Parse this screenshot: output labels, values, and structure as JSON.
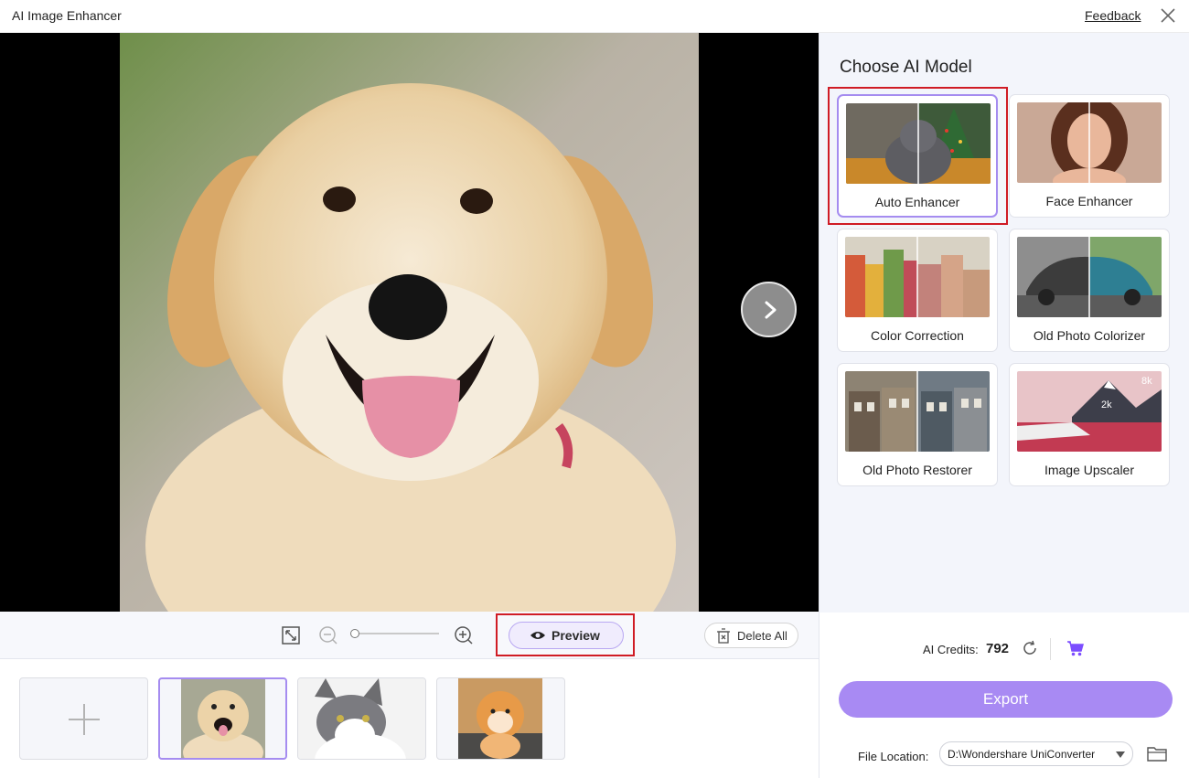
{
  "window": {
    "title": "AI Image Enhancer",
    "feedback_label": "Feedback"
  },
  "toolbar": {
    "preview_label": "Preview",
    "delete_all_label": "Delete All"
  },
  "panel": {
    "title": "Choose AI Model",
    "models": [
      {
        "label": "Auto Enhancer",
        "selected": true
      },
      {
        "label": "Face Enhancer",
        "selected": false
      },
      {
        "label": "Color Correction",
        "selected": false
      },
      {
        "label": "Old Photo Colorizer",
        "selected": false
      },
      {
        "label": "Old Photo Restorer",
        "selected": false
      },
      {
        "label": "Image Upscaler",
        "selected": false
      }
    ],
    "upscaler_badges": [
      "8k",
      "2k"
    ]
  },
  "footer": {
    "credits_label": "AI Credits:",
    "credits_value": "792",
    "export_label": "Export",
    "file_location_label": "File Location:",
    "file_location_value": "D:\\Wondershare UniConverter"
  },
  "colors": {
    "accent": "#a88af3",
    "highlight": "#d01c25",
    "cart": "#7c4dff"
  }
}
